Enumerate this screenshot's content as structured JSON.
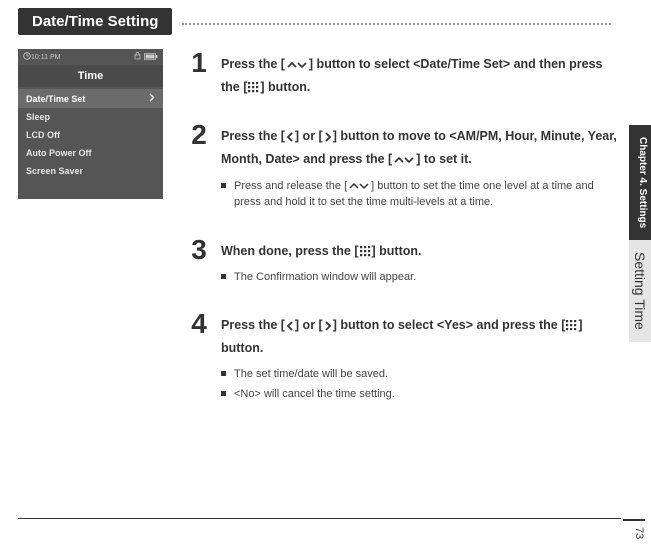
{
  "section_title": "Date/Time Setting",
  "device": {
    "clock": "10:11 PM",
    "title": "Time",
    "items": [
      {
        "label": "Date/Time Set",
        "selected": true
      },
      {
        "label": "Sleep",
        "selected": false
      },
      {
        "label": "LCD Off",
        "selected": false
      },
      {
        "label": "Auto Power Off",
        "selected": false
      },
      {
        "label": "Screen Saver",
        "selected": false
      }
    ]
  },
  "steps": {
    "s1": {
      "num": "1",
      "t_a": "Press the [",
      "t_b": "] button to select <Date/Time Set> and then press the [",
      "t_c": "] button."
    },
    "s2": {
      "num": "2",
      "t_a": "Press the [",
      "t_b": "] or [",
      "t_c": "] button to move to <AM/PM, Hour, Minute, Year, Month, Date> and press the [",
      "t_d": "] to set it.",
      "b1_a": "Press and release the [",
      "b1_b": "] button to set the time one level at a time and press and hold it to set the time multi-levels at a time."
    },
    "s3": {
      "num": "3",
      "t_a": "When done, press the [",
      "t_b": "] button.",
      "b1": "The Confirmation window will appear."
    },
    "s4": {
      "num": "4",
      "t_a": "Press the [",
      "t_b": "] or [",
      "t_c": "] button to select <Yes> and press the [",
      "t_d": "] button.",
      "b1": "The set time/date will be saved.",
      "b2": "<No> will cancel the time setting."
    }
  },
  "side": {
    "chapter": "Chapter 4. Settings",
    "section": "Setting Time"
  },
  "page_number": "73"
}
